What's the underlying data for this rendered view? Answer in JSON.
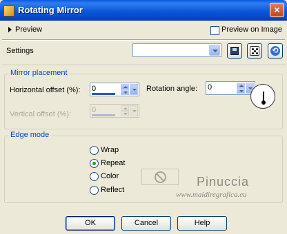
{
  "window": {
    "title": "Rotating Mirror",
    "close_glyph": "×"
  },
  "preview": {
    "label": "Preview",
    "preview_on_image_label": "Preview on Image",
    "preview_on_image_checked": false
  },
  "settings": {
    "label": "Settings",
    "preset_value": "",
    "icons": [
      "save-preset-icon",
      "randomize-icon",
      "reset-icon"
    ]
  },
  "mirror_placement": {
    "title": "Mirror placement",
    "horizontal_offset_label": "Horizontal offset (%):",
    "horizontal_offset_value": "0",
    "rotation_angle_label": "Rotation angle:",
    "rotation_angle_value": "0",
    "vertical_offset_label": "Vertical offset (%):",
    "vertical_offset_value": "0",
    "vertical_offset_enabled": false
  },
  "edge_mode": {
    "title": "Edge mode",
    "options": [
      {
        "label": "Wrap",
        "selected": false
      },
      {
        "label": "Repeat",
        "selected": true
      },
      {
        "label": "Color",
        "selected": false
      },
      {
        "label": "Reflect",
        "selected": false
      }
    ],
    "color_swatch_enabled": false
  },
  "watermark": {
    "line1": "Pinuccia",
    "line2": "www.maidiregrafica.eu"
  },
  "buttons": {
    "ok": "OK",
    "cancel": "Cancel",
    "help": "Help"
  },
  "colors": {
    "accent": "#0046d5",
    "title_bar": "#0a58d8",
    "dialog_bg": "#ece9d8",
    "selected_radio": "#21a121"
  }
}
